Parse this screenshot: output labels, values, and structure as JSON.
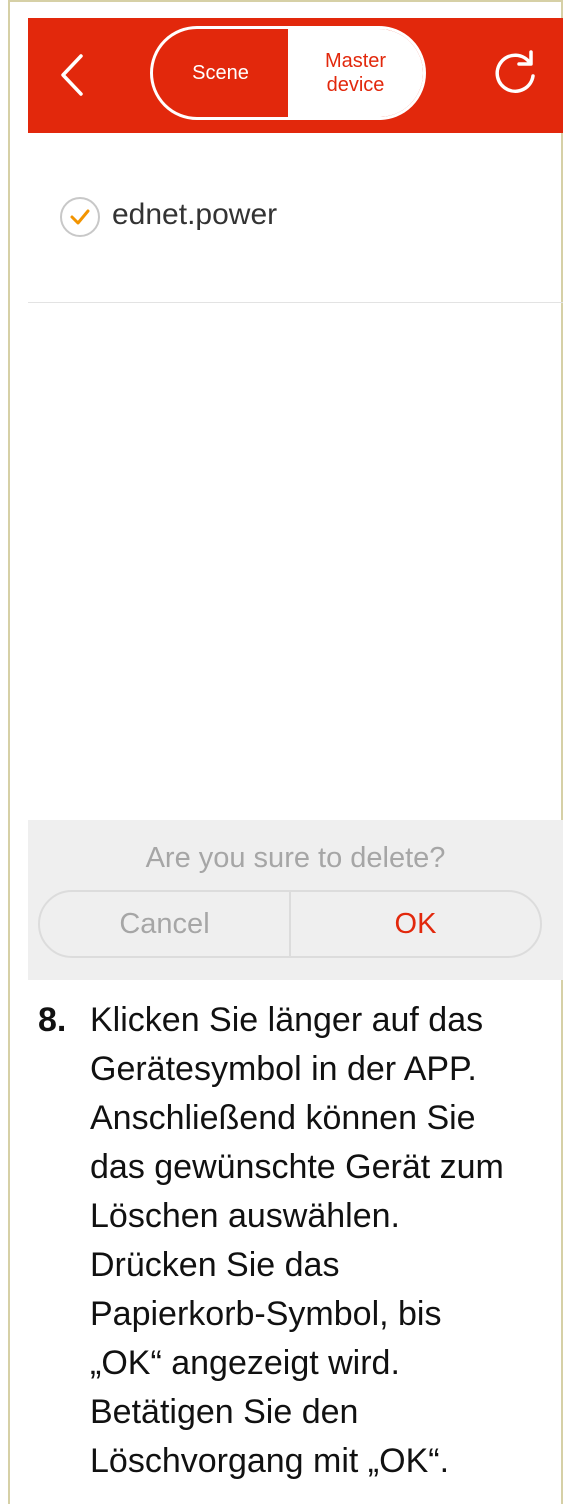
{
  "header": {
    "back_icon": "chevron-left-icon",
    "refresh_icon": "refresh-icon",
    "tabs": [
      {
        "label": "Scene",
        "active": false
      },
      {
        "label": "Master\ndevice",
        "active": true
      }
    ],
    "bg_color": "#e2280c"
  },
  "devices": [
    {
      "name": "ednet.power",
      "checked": true,
      "check_color": "#f29400"
    }
  ],
  "confirm_dialog": {
    "message": "Are you sure to delete?",
    "cancel_label": "Cancel",
    "ok_label": "OK"
  },
  "instruction": {
    "step_number": "8.",
    "text": "Klicken Sie länger auf das\nGerätesymbol in der APP.\nAnschließend können Sie\ndas gewünschte Gerät zum\nLöschen auswählen.\nDrücken Sie das\nPapierkorb-Symbol, bis\n„OK“ angezeigt wird.\nBetätigen Sie den\nLöschvorgang mit „OK“."
  }
}
